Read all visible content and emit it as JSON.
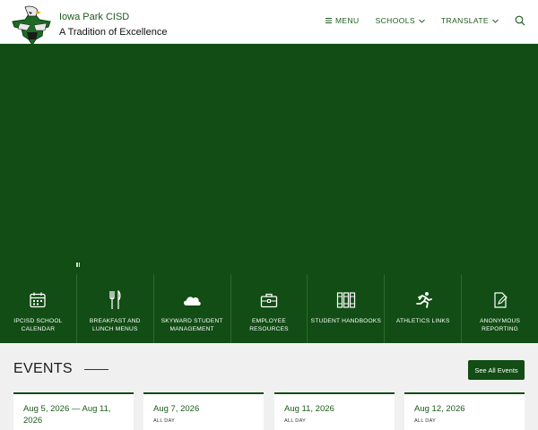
{
  "header": {
    "district_name": "Iowa Park CISD",
    "tagline": "A Tradition of Excellence",
    "nav": {
      "menu": "MENU",
      "schools": "SCHOOLS",
      "translate": "TRANSLATE"
    },
    "icons": {
      "menu": "hamburger-icon",
      "dropdown": "chevron-down-icon",
      "search": "search-icon",
      "logo": "hawk-texas-logo"
    }
  },
  "quick_links": [
    {
      "label": "IPCISD SCHOOL CALENDAR",
      "icon": "calendar-icon"
    },
    {
      "label": "BREAKFAST AND LUNCH MENUS",
      "icon": "fork-knife-icon"
    },
    {
      "label": "SKYWARD STUDENT MANAGEMENT",
      "icon": "cloud-icon"
    },
    {
      "label": "EMPLOYEE RESOURCES",
      "icon": "briefcase-icon"
    },
    {
      "label": "STUDENT HANDBOOKS",
      "icon": "books-icon"
    },
    {
      "label": "ATHLETICS LINKS",
      "icon": "runner-icon"
    },
    {
      "label": "ANONYMOUS REPORTING",
      "icon": "edit-document-icon"
    }
  ],
  "events": {
    "title": "EVENTS",
    "see_all": "See All Events",
    "cards": [
      {
        "date": "Aug 5, 2026 — Aug 11, 2026",
        "note": ""
      },
      {
        "date": "Aug 7, 2026",
        "note": "ALL DAY"
      },
      {
        "date": "Aug 11, 2026",
        "note": "ALL DAY"
      },
      {
        "date": "Aug 12, 2026",
        "note": "ALL DAY"
      }
    ]
  },
  "colors": {
    "brand_green": "#114d14",
    "text_green": "#1d5a1d",
    "events_bg": "#f0f0f0"
  }
}
